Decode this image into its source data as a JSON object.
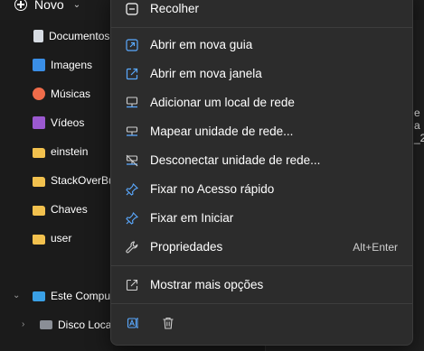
{
  "toolbar": {
    "new_label": "Novo"
  },
  "nav": {
    "items": [
      {
        "label": "Documentos",
        "icon": "document-icon"
      },
      {
        "label": "Imagens",
        "icon": "pictures-icon"
      },
      {
        "label": "Músicas",
        "icon": "music-icon"
      },
      {
        "label": "Vídeos",
        "icon": "videos-icon"
      },
      {
        "label": "einstein",
        "icon": "folder-icon"
      },
      {
        "label": "StackOverBu",
        "icon": "folder-icon"
      },
      {
        "label": "Chaves",
        "icon": "folder-icon"
      },
      {
        "label": "user",
        "icon": "folder-icon"
      }
    ],
    "this_pc": "Este Comput",
    "local_disk": "Disco Loca"
  },
  "context_menu": {
    "collapse": "Recolher",
    "items": [
      {
        "label": "Abrir em nova guia",
        "icon": "open-new-tab-icon"
      },
      {
        "label": "Abrir em nova janela",
        "icon": "open-new-window-icon"
      },
      {
        "label": "Adicionar um local de rede",
        "icon": "network-location-icon"
      },
      {
        "label": "Mapear unidade de rede...",
        "icon": "map-network-drive-icon"
      },
      {
        "label": "Desconectar unidade de rede...",
        "icon": "disconnect-network-drive-icon"
      },
      {
        "label": "Fixar no Acesso rápido",
        "icon": "pin-icon"
      },
      {
        "label": "Fixar em Iniciar",
        "icon": "pin-icon"
      },
      {
        "label": "Propriedades",
        "icon": "wrench-icon",
        "shortcut": "Alt+Enter"
      }
    ],
    "more_options": "Mostrar mais opções",
    "bottom_icons": [
      "rename-icon",
      "delete-icon"
    ]
  },
  "right_fragments": [
    "e a",
    "_2"
  ]
}
